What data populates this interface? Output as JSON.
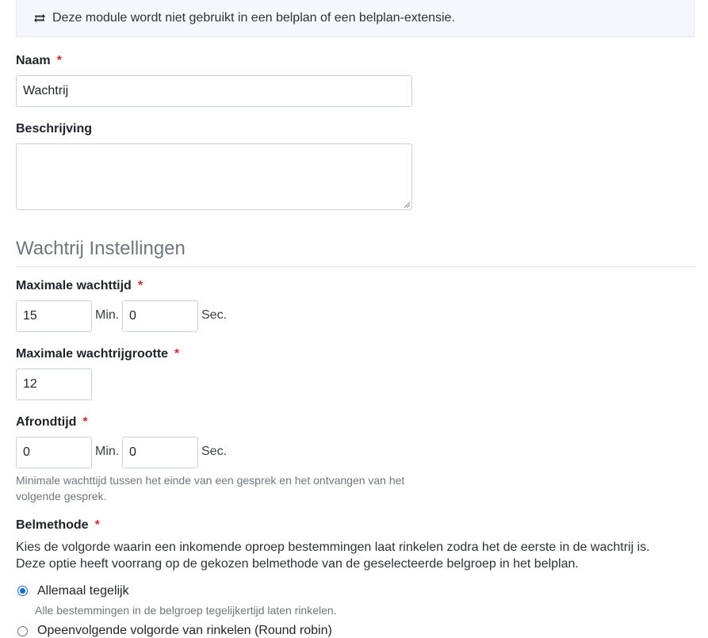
{
  "notice": {
    "icon": "repeat-icon",
    "text": "Deze module wordt niet gebruikt in een belplan of een belplan-extensie."
  },
  "name_field": {
    "label": "Naam",
    "required_mark": "*",
    "value": "Wachtrij"
  },
  "description_field": {
    "label": "Beschrijving",
    "value": ""
  },
  "section": {
    "title": "Wachtrij Instellingen"
  },
  "max_wait": {
    "label": "Maximale wachttijd",
    "required_mark": "*",
    "minutes": "15",
    "minutes_unit": "Min.",
    "seconds": "0",
    "seconds_unit": "Sec."
  },
  "max_queue_size": {
    "label": "Maximale wachtrijgrootte",
    "required_mark": "*",
    "value": "12"
  },
  "wrapup": {
    "label": "Afrondtijd",
    "required_mark": "*",
    "minutes": "0",
    "minutes_unit": "Min.",
    "seconds": "0",
    "seconds_unit": "Sec.",
    "help_line1": "Minimale wachttijd tussen het einde van een gesprek en het ontvangen van het",
    "help_line2": "volgende gesprek."
  },
  "ring_method": {
    "label": "Belmethode",
    "required_mark": "*",
    "description_line1": "Kies de volgorde waarin een inkomende oproep bestemmingen laat rinkelen zodra het de eerste in de wachtrij is.",
    "description_line2": "Deze optie heeft voorrang op de gekozen belmethode van de geselecteerde belgroep in het belplan.",
    "options": [
      {
        "label": "Allemaal tegelijk",
        "help": "Alle bestemmingen in de belgroep tegelijkertijd laten rinkelen.",
        "checked": true
      },
      {
        "label": "Opeenvolgende volgorde van rinkelen (Round robin)",
        "checked": false
      }
    ]
  },
  "colors": {
    "accent": "#1565e0",
    "required": "#d8262d"
  }
}
